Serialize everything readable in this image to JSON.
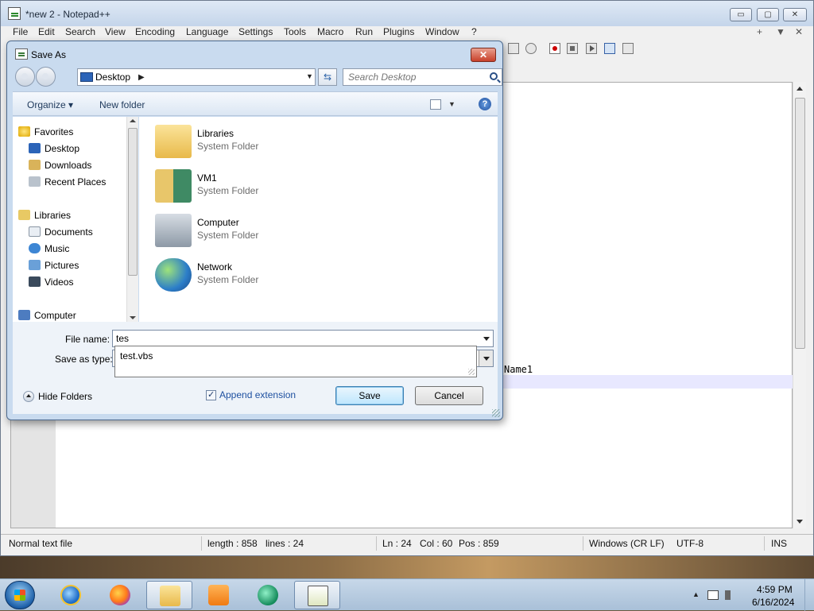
{
  "window": {
    "title": "*new 2 - Notepad++",
    "minimize": "▭",
    "maximize": "▢",
    "close": "✕"
  },
  "menubar": [
    "File",
    "Edit",
    "Search",
    "View",
    "Encoding",
    "Language",
    "Settings",
    "Tools",
    "Macro",
    "Run",
    "Plugins",
    "Window",
    "?"
  ],
  "menubar_right": [
    "+",
    "▼",
    "✕"
  ],
  "editor": {
    "visible_fragment": "Name1"
  },
  "statusbar": {
    "filetype": "Normal text file",
    "length": "length : 858",
    "lines": "lines : 24",
    "ln": "Ln : 24",
    "col": "Col : 60",
    "pos": "Pos : 859",
    "eol": "Windows (CR LF)",
    "encoding": "UTF-8",
    "mode": "INS"
  },
  "dialog": {
    "title": "Save As",
    "close": "✕",
    "address": "Desktop",
    "address_sep": "▶",
    "address_drop": "▼",
    "refresh": "⇆",
    "search_placeholder": "Search Desktop",
    "organize": "Organize ▾",
    "new_folder": "New folder",
    "view_drop": "▼",
    "help": "?",
    "nav": {
      "favorites": "Favorites",
      "desktop": "Desktop",
      "downloads": "Downloads",
      "recent": "Recent Places",
      "libraries": "Libraries",
      "documents": "Documents",
      "music": "Music",
      "pictures": "Pictures",
      "videos": "Videos",
      "computer": "Computer"
    },
    "files": [
      {
        "name": "Libraries",
        "type": "System Folder"
      },
      {
        "name": "VM1",
        "type": "System Folder"
      },
      {
        "name": "Computer",
        "type": "System Folder"
      },
      {
        "name": "Network",
        "type": "System Folder"
      }
    ],
    "file_name_label": "File name:",
    "file_name_value": "tes",
    "save_type_label": "Save as type:",
    "autocomplete": [
      "test.vbs"
    ],
    "hide_folders": "Hide Folders",
    "append_extension": "Append extension",
    "save": "Save",
    "cancel": "Cancel"
  },
  "taskbar": {
    "time": "4:59 PM",
    "date": "6/16/2024"
  },
  "colors": {
    "dialog_bg": "#c9dbef",
    "accent": "#1e50a0",
    "close_red": "#c8402a"
  }
}
